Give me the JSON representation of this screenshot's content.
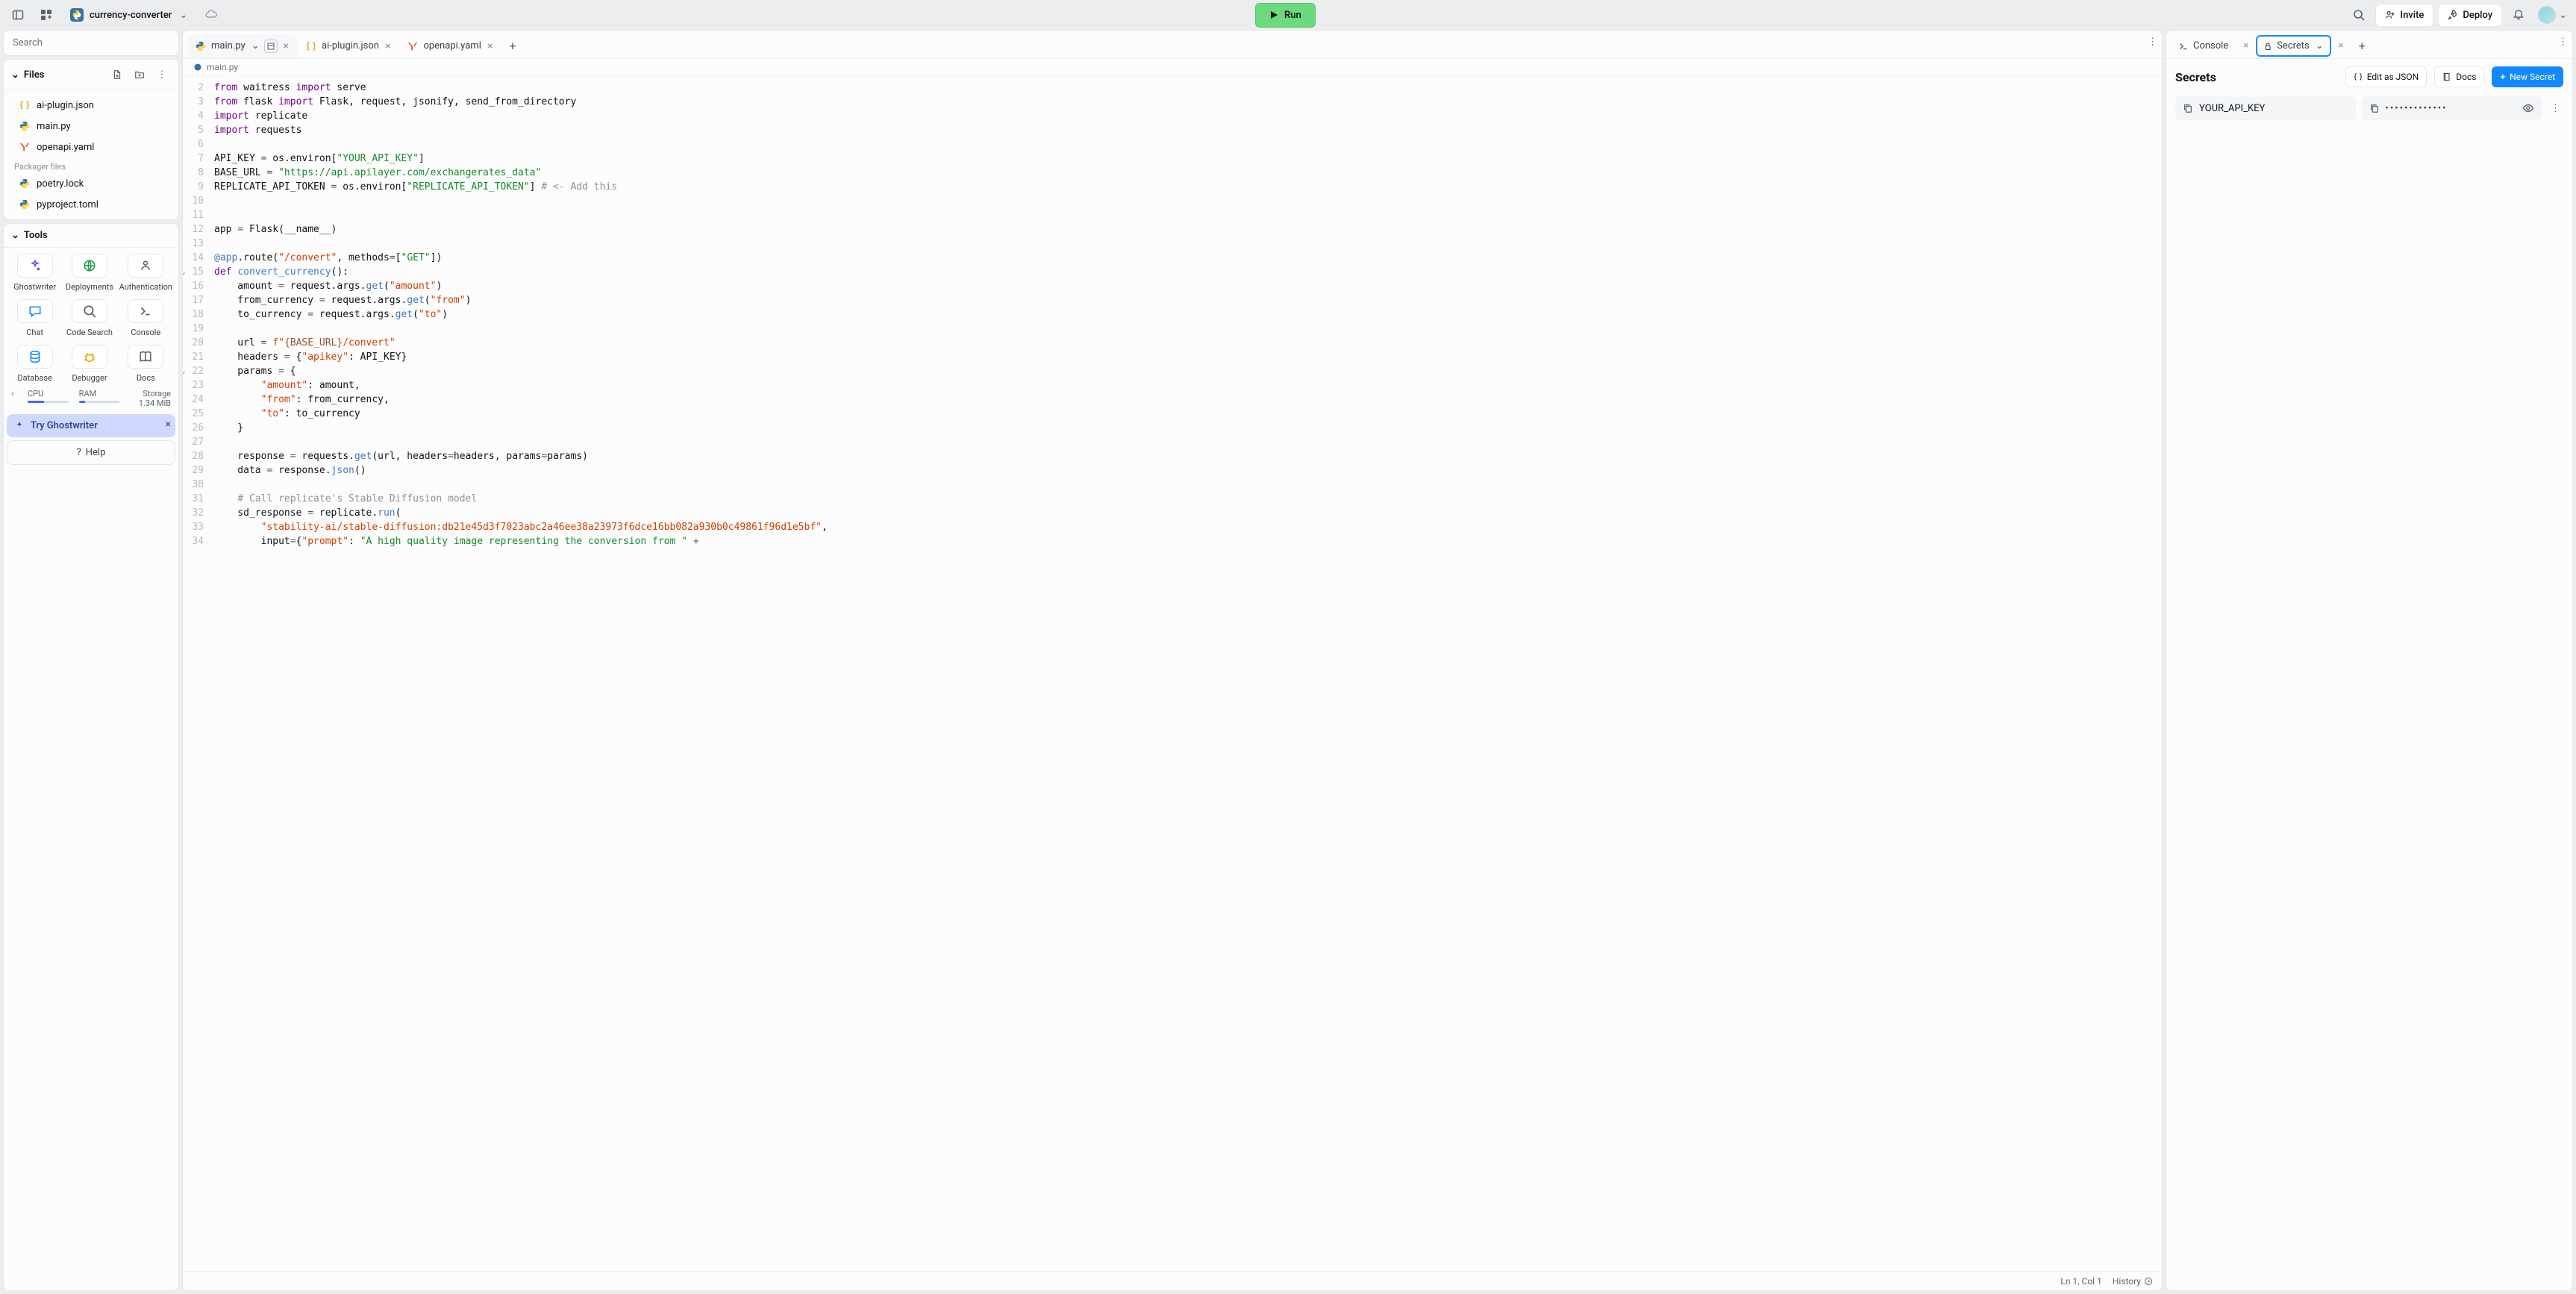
{
  "header": {
    "project_name": "currency-converter",
    "run_label": "Run",
    "invite_label": "Invite",
    "deploy_label": "Deploy"
  },
  "search": {
    "placeholder": "Search"
  },
  "files": {
    "header": "Files",
    "items": [
      {
        "name": "ai-plugin.json",
        "type": "json"
      },
      {
        "name": "main.py",
        "type": "py"
      },
      {
        "name": "openapi.yaml",
        "type": "yaml"
      }
    ],
    "packager_label": "Packager files",
    "packager_items": [
      {
        "name": "poetry.lock",
        "type": "py"
      },
      {
        "name": "pyproject.toml",
        "type": "py"
      }
    ]
  },
  "tools": {
    "header": "Tools",
    "items": [
      "Ghostwriter",
      "Deployments",
      "Authentication",
      "Chat",
      "Code Search",
      "Console",
      "Database",
      "Debugger",
      "Docs"
    ]
  },
  "stats": {
    "cpu": {
      "label": "CPU",
      "pct": 40
    },
    "ram": {
      "label": "RAM",
      "pct": 15
    },
    "storage": {
      "label": "Storage",
      "value": "1.34 MiB"
    }
  },
  "ghostwriter_cta": "Try Ghostwriter",
  "help_label": "Help",
  "editor": {
    "tabs": [
      {
        "name": "main.py",
        "type": "py",
        "active": true,
        "dropdown": true
      },
      {
        "name": "ai-plugin.json",
        "type": "json"
      },
      {
        "name": "openapi.yaml",
        "type": "yaml"
      }
    ],
    "breadcrumb": "main.py",
    "status": {
      "cursor": "Ln 1, Col 1",
      "history": "History"
    },
    "first_line_number": 2,
    "code_lines": [
      {
        "n": 2,
        "html": "<span class='kw'>from</span> waitress <span class='kw'>import</span> serve"
      },
      {
        "n": 3,
        "html": "<span class='kw'>from</span> flask <span class='kw'>import</span> Flask, request, jsonify, send_from_directory"
      },
      {
        "n": 4,
        "html": "<span class='kw'>import</span> replicate"
      },
      {
        "n": 5,
        "html": "<span class='kw'>import</span> requests"
      },
      {
        "n": 6,
        "html": ""
      },
      {
        "n": 7,
        "html": "API_KEY <span class='op'>=</span> os.environ[<span class='strg'>\"YOUR_API_KEY\"</span>]"
      },
      {
        "n": 8,
        "html": "BASE_URL <span class='op'>=</span> <span class='strg'>\"https://api.apilayer.com/exchangerates_data\"</span>"
      },
      {
        "n": 9,
        "html": "REPLICATE_API_TOKEN <span class='op'>=</span> os.environ[<span class='strg'>\"REPLICATE_API_TOKEN\"</span>] <span class='cmt'># &lt;- Add this</span>"
      },
      {
        "n": 10,
        "html": ""
      },
      {
        "n": 11,
        "html": ""
      },
      {
        "n": 12,
        "html": "app <span class='op'>=</span> Flask(__name__)"
      },
      {
        "n": 13,
        "html": ""
      },
      {
        "n": 14,
        "html": "<span class='call'>@app</span>.route(<span class='str'>\"/convert\"</span>, methods<span class='op'>=</span>[<span class='strg'>\"GET\"</span>])"
      },
      {
        "n": 15,
        "html": "<span class='kw'>def</span> <span class='call'>convert_currency</span>():",
        "fold": true
      },
      {
        "n": 16,
        "html": "    amount <span class='op'>=</span> request.args.<span class='call'>get</span>(<span class='str'>\"amount\"</span>)"
      },
      {
        "n": 17,
        "html": "    from_currency <span class='op'>=</span> request.args.<span class='call'>get</span>(<span class='str'>\"from\"</span>)"
      },
      {
        "n": 18,
        "html": "    to_currency <span class='op'>=</span> request.args.<span class='call'>get</span>(<span class='str'>\"to\"</span>)"
      },
      {
        "n": 19,
        "html": ""
      },
      {
        "n": 20,
        "html": "    url <span class='op'>=</span> <span class='str'>f\"</span><span class='brown'>{BASE_URL}</span><span class='str'>/convert\"</span>"
      },
      {
        "n": 21,
        "html": "    headers <span class='op'>=</span> {<span class='str'>\"apikey\"</span>: API_KEY}"
      },
      {
        "n": 22,
        "html": "    params <span class='op'>=</span> {",
        "fold": true
      },
      {
        "n": 23,
        "html": "        <span class='str'>\"amount\"</span>: amount,"
      },
      {
        "n": 24,
        "html": "        <span class='str'>\"from\"</span>: from_currency,"
      },
      {
        "n": 25,
        "html": "        <span class='str'>\"to\"</span>: to_currency"
      },
      {
        "n": 26,
        "html": "    }"
      },
      {
        "n": 27,
        "html": ""
      },
      {
        "n": 28,
        "html": "    response <span class='op'>=</span> requests.<span class='call'>get</span>(url, headers<span class='op'>=</span>headers, params<span class='op'>=</span>params)"
      },
      {
        "n": 29,
        "html": "    data <span class='op'>=</span> response.<span class='call'>json</span>()"
      },
      {
        "n": 30,
        "html": ""
      },
      {
        "n": 31,
        "html": "    <span class='cmt'># Call replicate's Stable Diffusion model</span>"
      },
      {
        "n": 32,
        "html": "    sd_response <span class='op'>=</span> replicate.<span class='call'>run</span>("
      },
      {
        "n": 33,
        "html": "        <span class='str'>\"stability-ai/stable-diffusion:db21e45d3f7023abc2a46ee38a23973f6dce16bb082a930b0c49861f96d1e5bf\"</span>,",
        "wrap": true
      },
      {
        "n": 34,
        "html": "        input<span class='op'>=</span>{<span class='str'>\"prompt\"</span>: <span class='strg'>\"A high quality image representing the conversion from \"</span> <span class='op'>+</span>"
      }
    ]
  },
  "right": {
    "tabs": [
      {
        "name": "Console",
        "type": "console"
      },
      {
        "name": "Secrets",
        "type": "secrets",
        "active": true,
        "dropdown": true
      }
    ],
    "secrets": {
      "title": "Secrets",
      "edit_json": "Edit as JSON",
      "docs": "Docs",
      "new_secret": "New Secret",
      "rows": [
        {
          "key": "YOUR_API_KEY",
          "masked": "•••••••••••••"
        }
      ]
    }
  }
}
